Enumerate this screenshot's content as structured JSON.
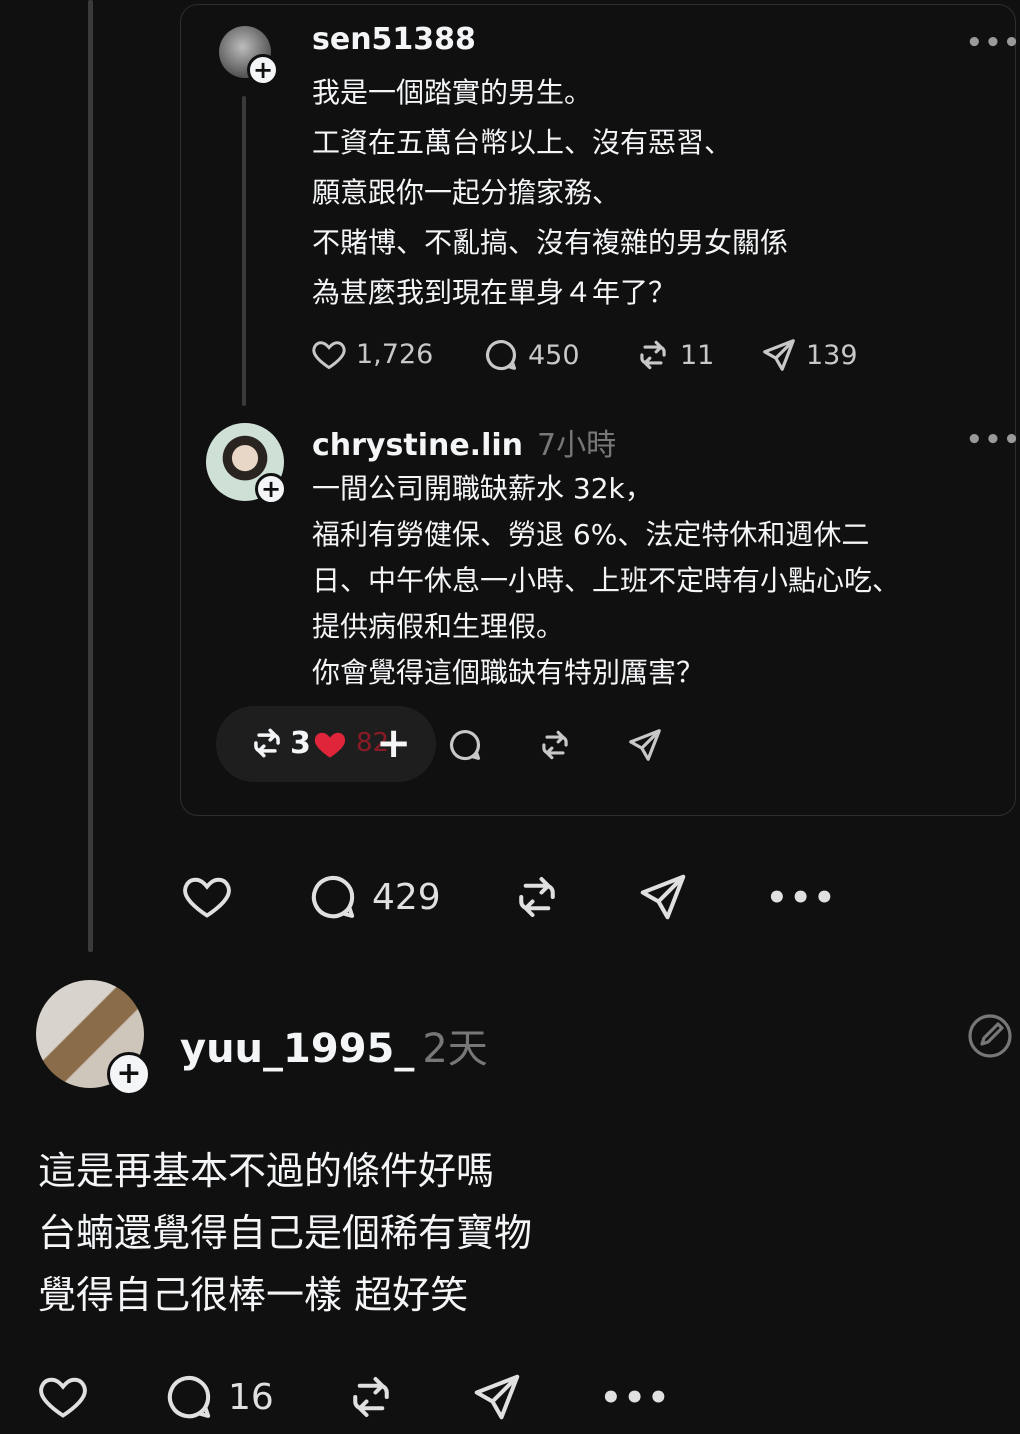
{
  "quoted_post": {
    "username": "sen51388",
    "more_label": "•••",
    "lines": [
      "我是一個踏實的男生。",
      "工資在五萬台幣以上、沒有惡習、",
      "願意跟你一起分擔家務、",
      "不賭博、不亂搞、沒有複雜的男女關係",
      "為甚麼我到現在單身４年了？"
    ],
    "likes": "1,726",
    "replies": "450",
    "reposts": "11",
    "shares": "139"
  },
  "reply_post": {
    "username": "chrystine.lin",
    "time": "7小時",
    "more_label": "•••",
    "lines": [
      "一間公司開職缺薪水 32k，",
      "福利有勞健保、勞退 6%、法定特休和週休二",
      "日、中午休息一小時、上班不定時有小點心吃、",
      "提供病假和生理假。",
      "你會覺得這個職缺有特別厲害？"
    ],
    "repost_count": "3",
    "like_count_partial": "82",
    "plus_label": "+"
  },
  "outer_actions": {
    "replies": "429",
    "more_label": "•••"
  },
  "comment": {
    "username": "yuu_1995_",
    "time": "2天",
    "lines": [
      "這是再基本不過的條件好嗎",
      "台蝻還覺得自己是個稀有寶物",
      "覺得自己很棒一樣 超好笑"
    ],
    "replies": "16",
    "more_label": "•••"
  },
  "colors": {
    "background": "#101010",
    "text": "#f3f5f7",
    "muted": "#777777",
    "heart_red": "#e0243a"
  }
}
